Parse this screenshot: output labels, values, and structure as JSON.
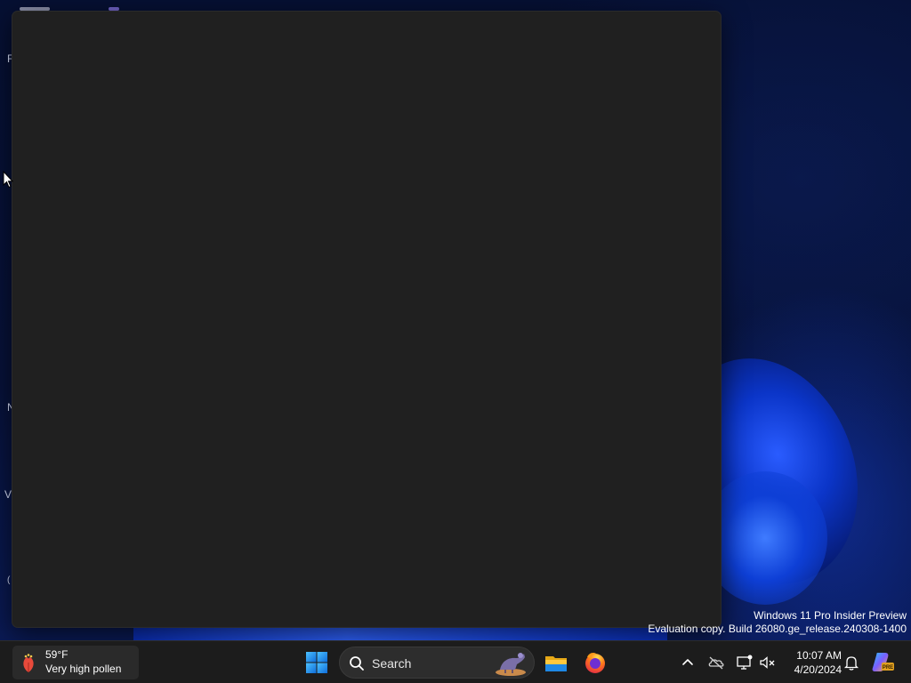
{
  "desktop": {
    "icon_letters": [
      "F",
      "N",
      "V",
      "("
    ],
    "watermark": {
      "line1": "Windows 11 Pro Insider Preview",
      "line2": "Evaluation copy. Build 26080.ge_release.240308-1400"
    }
  },
  "taskbar": {
    "weather": {
      "temperature": "59°F",
      "description": "Very high pollen",
      "icon": "pollen-icon"
    },
    "start_icon": "windows-logo-icon",
    "search": {
      "label": "Search",
      "icon": "search-icon"
    },
    "apps": [
      {
        "name": "File Explorer",
        "icon": "folder-icon"
      },
      {
        "name": "Firefox",
        "icon": "firefox-icon"
      }
    ],
    "tray": {
      "icons": [
        "chevron-up-icon",
        "onedrive-icon",
        "network-icon",
        "volume-muted-icon"
      ],
      "time": "10:07 AM",
      "date": "4/20/2024",
      "notification_icon": "bell-icon",
      "copilot_badge": "PRE"
    }
  },
  "colors": {
    "accent": "#0078d4",
    "taskbar_bg": "#1c1c1c",
    "window_bg": "#202020"
  }
}
